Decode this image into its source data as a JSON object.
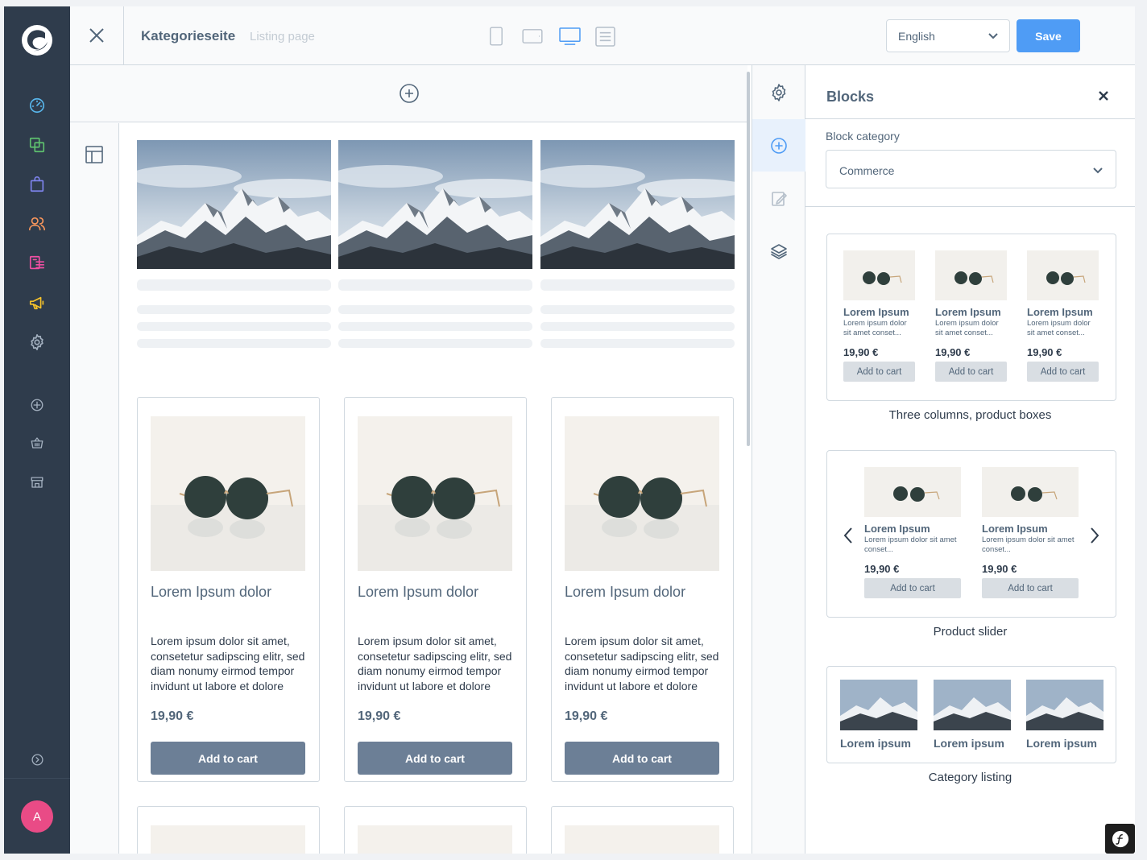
{
  "nav": {
    "items": [
      {
        "name": "dashboard-icon",
        "color": "#58b5ea"
      },
      {
        "name": "catalogue-icon",
        "color": "#5ec06e"
      },
      {
        "name": "orders-icon",
        "color": "#7e84ed"
      },
      {
        "name": "customers-icon",
        "color": "#f8965c"
      },
      {
        "name": "content-icon",
        "color": "#ef4fa3"
      },
      {
        "name": "marketing-icon",
        "color": "#f7c32a"
      },
      {
        "name": "settings-icon",
        "color": "#a3b0bf"
      },
      {
        "name": "add-icon",
        "color": "#a3b0bf"
      },
      {
        "name": "basket-icon",
        "color": "#a3b0bf"
      },
      {
        "name": "store-icon",
        "color": "#a3b0bf"
      }
    ],
    "collapse_icon": "chevron-right-circle-icon",
    "avatar_initial": "A",
    "avatar_color": "#e94b86"
  },
  "topbar": {
    "title": "Kategorieseite",
    "subtitle": "Listing page",
    "devices": [
      "mobile-icon",
      "tablet-icon",
      "desktop-icon",
      "form-icon"
    ],
    "active_device": "desktop-icon",
    "language": "English",
    "save_label": "Save"
  },
  "canvas": {
    "products": [
      {
        "title": "Lorem Ipsum dolor",
        "description": "Lorem ipsum dolor sit amet, consetetur sadipscing elitr, sed diam nonumy eirmod tempor invidunt ut labore et dolore",
        "price": "19,90 €",
        "button": "Add to cart"
      },
      {
        "title": "Lorem Ipsum dolor",
        "description": "Lorem ipsum dolor sit amet, consetetur sadipscing elitr, sed diam nonumy eirmod tempor invidunt ut labore et dolore",
        "price": "19,90 €",
        "button": "Add to cart"
      },
      {
        "title": "Lorem Ipsum dolor",
        "description": "Lorem ipsum dolor sit amet, consetetur sadipscing elitr, sed diam nonumy eirmod tempor invidunt ut labore et dolore",
        "price": "19,90 €",
        "button": "Add to cart"
      }
    ]
  },
  "tools": [
    "gear-icon",
    "plus-circle-icon",
    "edit-icon",
    "layers-icon"
  ],
  "blocks": {
    "title": "Blocks",
    "category_label": "Block category",
    "category_value": "Commerce",
    "previews": [
      {
        "name": "Three columns, product boxes",
        "items": [
          {
            "title": "Lorem Ipsum",
            "desc": "Lorem ipsum dolor sit amet conset...",
            "price": "19,90 €",
            "button": "Add to cart"
          },
          {
            "title": "Lorem Ipsum",
            "desc": "Lorem ipsum dolor sit amet conset...",
            "price": "19,90 €",
            "button": "Add to cart"
          },
          {
            "title": "Lorem Ipsum",
            "desc": "Lorem ipsum dolor sit amet conset...",
            "price": "19,90 €",
            "button": "Add to cart"
          }
        ]
      },
      {
        "name": "Product slider",
        "items": [
          {
            "title": "Lorem Ipsum",
            "desc": "Lorem ipsum dolor sit amet conset...",
            "price": "19,90 €",
            "button": "Add to cart"
          },
          {
            "title": "Lorem Ipsum",
            "desc": "Lorem ipsum dolor sit amet conset...",
            "price": "19,90 €",
            "button": "Add to cart"
          }
        ]
      },
      {
        "name": "Category listing",
        "items": [
          {
            "label": "Lorem ipsum"
          },
          {
            "label": "Lorem ipsum"
          },
          {
            "label": "Lorem ipsum"
          }
        ]
      }
    ]
  },
  "colors": {
    "accent": "#4f9cf5",
    "nav_bg": "#2f3c4c",
    "button_bg": "#6c7f96"
  }
}
